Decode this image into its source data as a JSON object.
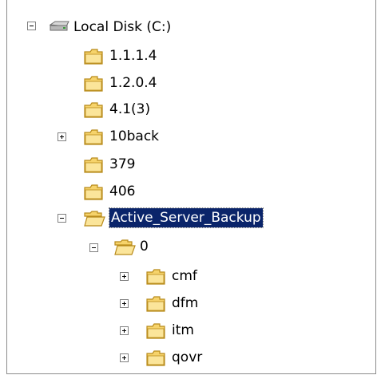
{
  "tree": {
    "root": {
      "label": "Local Disk (C:)",
      "icon": "hard-drive-icon",
      "expanded": true
    },
    "children": [
      {
        "label": "1.1.1.4",
        "icon": "folder-icon",
        "has_children": false
      },
      {
        "label": "1.2.0.4",
        "icon": "folder-icon",
        "has_children": false
      },
      {
        "label": "4.1(3)",
        "icon": "folder-icon",
        "has_children": false
      },
      {
        "label": "10back",
        "icon": "folder-icon",
        "has_children": true,
        "expanded": false
      },
      {
        "label": "379",
        "icon": "folder-icon",
        "has_children": false
      },
      {
        "label": "406",
        "icon": "folder-icon",
        "has_children": false
      },
      {
        "label": "Active_Server_Backup",
        "icon": "folder-open-icon",
        "has_children": true,
        "expanded": true,
        "selected": true
      },
      {
        "label": "0",
        "icon": "folder-open-icon",
        "has_children": true,
        "expanded": true
      },
      {
        "label": "cmf",
        "icon": "folder-icon",
        "has_children": true,
        "expanded": false
      },
      {
        "label": "dfm",
        "icon": "folder-icon",
        "has_children": true,
        "expanded": false
      },
      {
        "label": "itm",
        "icon": "folder-icon",
        "has_children": true,
        "expanded": false
      },
      {
        "label": "qovr",
        "icon": "folder-icon",
        "has_children": true,
        "expanded": false
      }
    ]
  },
  "colors": {
    "selection": "#0a246a",
    "folder": "#f6d36b",
    "folder_outline": "#b88a1a"
  }
}
